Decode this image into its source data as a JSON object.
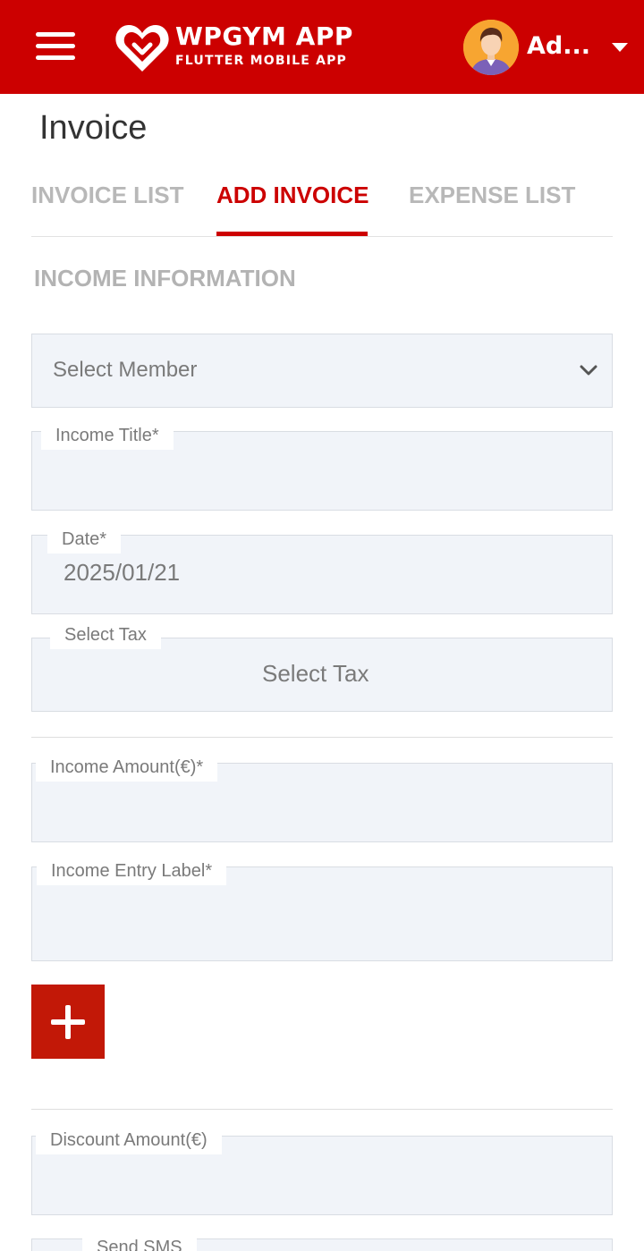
{
  "header": {
    "logo_title": "WPGYM APP",
    "logo_subtitle": "FLUTTER MOBILE APP",
    "user_name": "Ad...",
    "brand_color": "#cc0000",
    "icons": [
      "hamburger-menu-icon",
      "heart-logo-icon",
      "user-avatar",
      "caret-down-icon"
    ]
  },
  "page": {
    "title": "Invoice"
  },
  "tabs": [
    {
      "label": "INVOICE LIST",
      "active": false
    },
    {
      "label": "ADD INVOICE",
      "active": true
    },
    {
      "label": "EXPENSE LIST",
      "active": false
    }
  ],
  "form": {
    "section_title": "INCOME INFORMATION",
    "select_member": {
      "placeholder": "Select Member"
    },
    "income_title": {
      "label": "Income Title*",
      "value": ""
    },
    "date": {
      "label": "Date*",
      "value": "2025/01/21"
    },
    "tax": {
      "label": "Select Tax",
      "value": "Select Tax"
    },
    "income_amount": {
      "label": "Income Amount(€)*",
      "value": ""
    },
    "income_entry_label": {
      "label": "Income Entry Label*",
      "value": ""
    },
    "discount_amount": {
      "label": "Discount Amount(€)",
      "value": ""
    },
    "send_sms": {
      "label": "Send SMS"
    }
  }
}
